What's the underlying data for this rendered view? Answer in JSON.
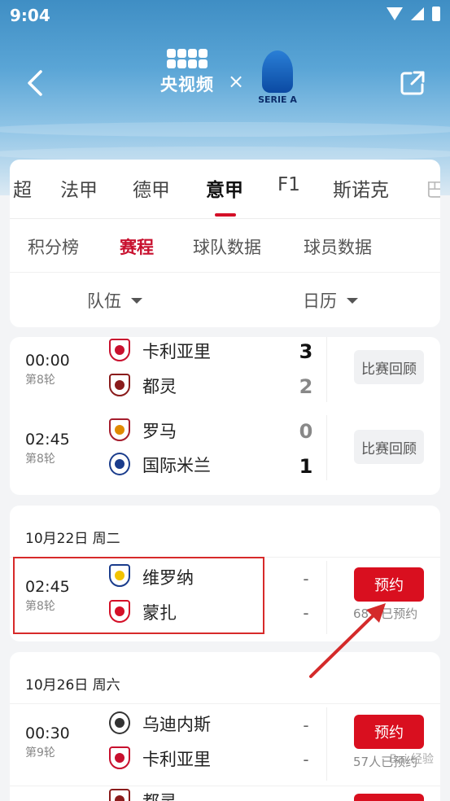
{
  "status_bar": {
    "time": "9:04"
  },
  "header": {
    "brand_name": "央视频",
    "times_symbol": "×",
    "partner_label": "SERIE A"
  },
  "league_tabs": [
    {
      "label": "超",
      "active": false
    },
    {
      "label": "法甲",
      "active": false
    },
    {
      "label": "德甲",
      "active": false
    },
    {
      "label": "意甲",
      "active": true
    },
    {
      "label": "F1",
      "active": false
    },
    {
      "label": "斯诺克",
      "active": false
    },
    {
      "label": "巴",
      "active": false
    }
  ],
  "sub_tabs": [
    {
      "label": "积分榜",
      "active": false
    },
    {
      "label": "赛程",
      "active": true
    },
    {
      "label": "球队数据",
      "active": false
    },
    {
      "label": "球员数据",
      "active": false
    }
  ],
  "filters": {
    "team": "队伍",
    "calendar": "日历"
  },
  "match_groups": [
    {
      "date": "",
      "matches": [
        {
          "time": "00:00",
          "round": "第8轮",
          "home": {
            "name": "卡利亚里",
            "score": "3",
            "color": "#c8102e"
          },
          "away": {
            "name": "都灵",
            "score": "2",
            "color": "#8a1c1c"
          },
          "action": "比赛回顾"
        },
        {
          "time": "02:45",
          "round": "第8轮",
          "home": {
            "name": "罗马",
            "score": "0",
            "color": "#a51d2d"
          },
          "away": {
            "name": "国际米兰",
            "score": "1",
            "color": "#1a3c8c"
          },
          "action": "比赛回顾"
        }
      ]
    },
    {
      "date": "10月22日 周二",
      "matches": [
        {
          "time": "02:45",
          "round": "第8轮",
          "home": {
            "name": "维罗纳",
            "score": "-",
            "color": "#1a3c8c"
          },
          "away": {
            "name": "蒙扎",
            "score": "-",
            "color": "#d40f27"
          },
          "action": "预约",
          "reserved": "68人已预约"
        }
      ]
    },
    {
      "date": "10月26日 周六",
      "matches": [
        {
          "time": "00:30",
          "round": "第9轮",
          "home": {
            "name": "乌迪内斯",
            "score": "-",
            "color": "#333333"
          },
          "away": {
            "name": "卡利亚里",
            "score": "-",
            "color": "#c8102e"
          },
          "action": "预约",
          "reserved": "57人已预约"
        },
        {
          "time": "",
          "round": "",
          "home": {
            "name": "都灵",
            "score": "",
            "color": "#8a1c1c"
          },
          "action": "预约"
        }
      ]
    }
  ],
  "watermark": "Bai 经验"
}
